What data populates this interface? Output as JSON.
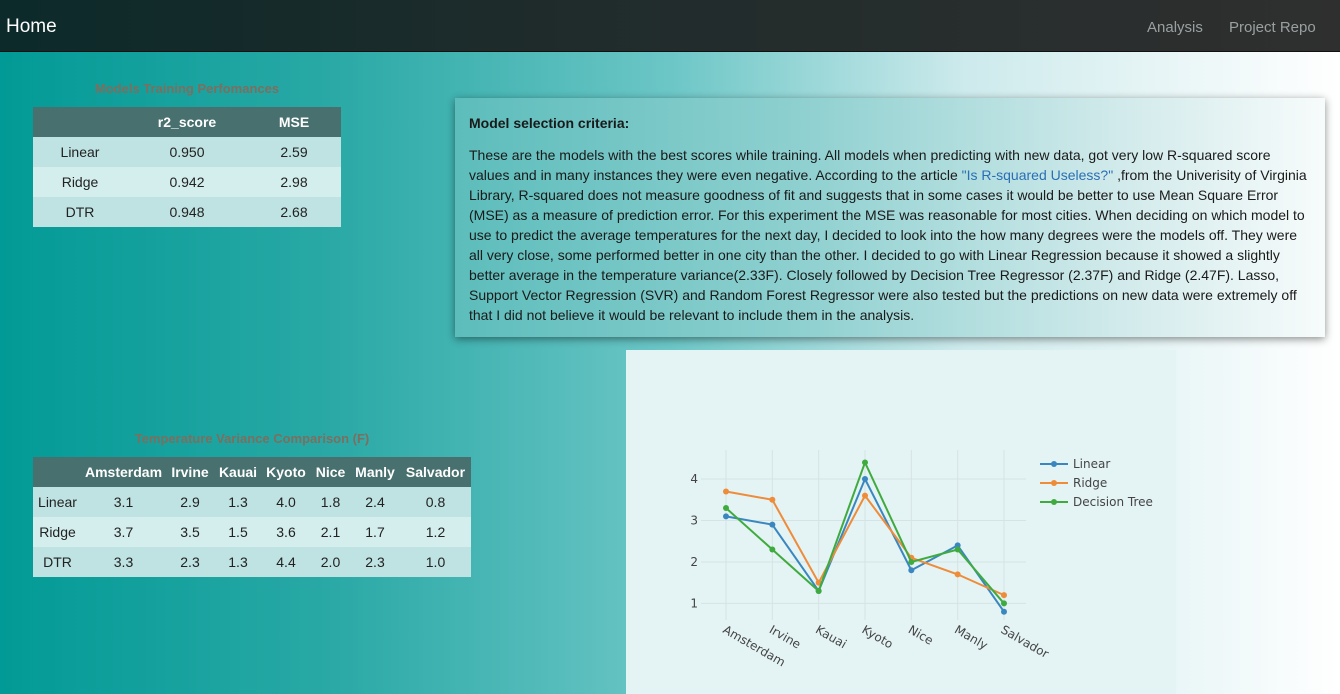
{
  "nav": {
    "brand": "Home",
    "links": [
      "Analysis",
      "Project Repo"
    ]
  },
  "training_table": {
    "title": "Models Training Perfomances",
    "headers": [
      "",
      "r2_score",
      "MSE"
    ],
    "rows": [
      [
        "Linear",
        "0.950",
        "2.59"
      ],
      [
        "Ridge",
        "0.942",
        "2.98"
      ],
      [
        "DTR",
        "0.948",
        "2.68"
      ]
    ]
  },
  "criteria": {
    "title": "Model selection criteria:",
    "text_before_link": "These are the models with the best scores while training. All models when predicting with new data, got very low R-squared score values and in many instances they were even negative. According to the article ",
    "link_text": "\"Is R-squared Useless?\"",
    "text_after_link": " ,from the Univerisity of Virginia Library, R-squared does not measure goodness of fit and suggests that in some cases it would be better to use Mean Square Error (MSE) as a measure of prediction error. For this experiment the MSE was reasonable for most cities. When deciding on which model to use to predict the average temperatures for the next day, I decided to look into the how many degrees were the models off. They were all very close, some performed better in one city than the other. I decided to go with Linear Regression because it showed a slightly better average in the temperature variance(2.33F). Closely followed by Decision Tree Regressor (2.37F) and Ridge (2.47F). Lasso, Support Vector Regression (SVR) and Random Forest Regressor were also tested but the predictions on new data were extremely off that I did not believe it would be relevant to include them in the analysis."
  },
  "variance_table": {
    "title": "Temperature Variance Comparison (F)",
    "headers": [
      "",
      "Amsterdam",
      "Irvine",
      "Kauai",
      "Kyoto",
      "Nice",
      "Manly",
      "Salvador"
    ],
    "rows": [
      [
        "Linear",
        "3.1",
        "2.9",
        "1.3",
        "4.0",
        "1.8",
        "2.4",
        "0.8"
      ],
      [
        "Ridge",
        "3.7",
        "3.5",
        "1.5",
        "3.6",
        "2.1",
        "1.7",
        "1.2"
      ],
      [
        "DTR",
        "3.3",
        "2.3",
        "1.3",
        "4.4",
        "2.0",
        "2.3",
        "1.0"
      ]
    ]
  },
  "chart_data": {
    "type": "line",
    "categories": [
      "Amsterdam",
      "Irvine",
      "Kauai",
      "Kyoto",
      "Nice",
      "Manly",
      "Salvador"
    ],
    "series": [
      {
        "name": "Linear",
        "color": "#3a87c0",
        "values": [
          3.1,
          2.9,
          1.3,
          4.0,
          1.8,
          2.4,
          0.8
        ]
      },
      {
        "name": "Ridge",
        "color": "#ee8c3a",
        "values": [
          3.7,
          3.5,
          1.5,
          3.6,
          2.1,
          1.7,
          1.2
        ]
      },
      {
        "name": "Decision Tree",
        "color": "#3fab3f",
        "values": [
          3.3,
          2.3,
          1.3,
          4.4,
          2.0,
          2.3,
          1.0
        ]
      }
    ],
    "yticks": [
      1,
      2,
      3,
      4
    ],
    "ylim": [
      0.6,
      4.7
    ],
    "grid": true,
    "legend": "top-right"
  }
}
